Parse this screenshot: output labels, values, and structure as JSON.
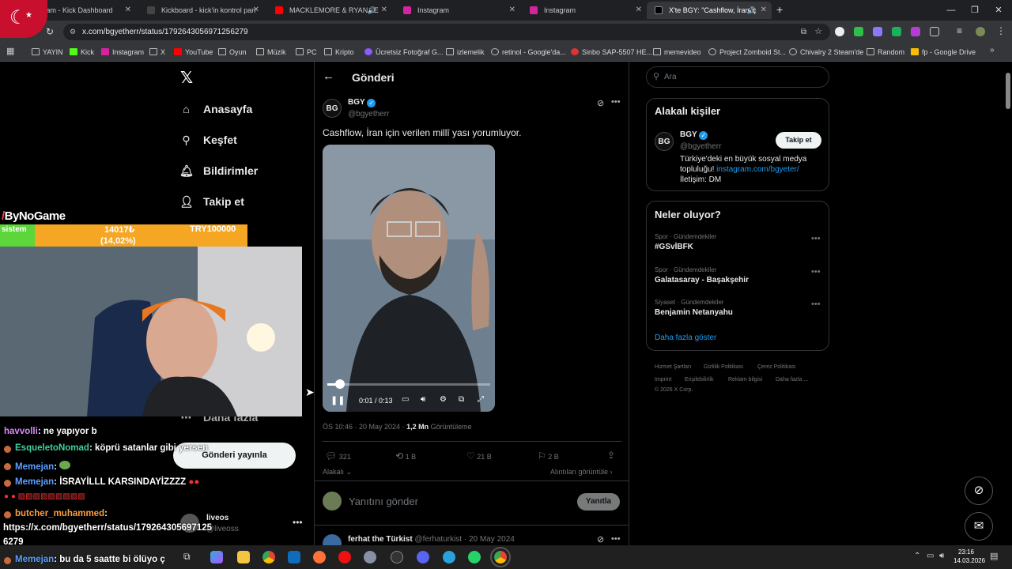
{
  "browser": {
    "tabs": [
      {
        "title": "Stream - Kick Dashboard"
      },
      {
        "title": "Kickboard - kick'in kontrol pan"
      },
      {
        "title": "MACKLEMORE & RYAN LE"
      },
      {
        "title": "Instagram"
      },
      {
        "title": "Instagram"
      },
      {
        "title": "X'te BGY: \"Cashflow, İran iç"
      }
    ],
    "url": "x.com/bgyetherr/status/1792643056971256279",
    "bookmarks": [
      "YAYIN",
      "Kick",
      "Instagram",
      "X",
      "YouTube",
      "Oyun",
      "Müzik",
      "PC",
      "Kripto",
      "Ücretsiz Fotoğraf G...",
      "izlemelik",
      "retinol - Google'da...",
      "Sinbo SAP-5507 HE...",
      "memevideo",
      "Project Zomboid St...",
      "Chivalry 2 Steam'de",
      "Random",
      "fp - Google Drive"
    ],
    "colors": {
      "tab_bar": "#1f2023",
      "toolbar": "#35363a"
    }
  },
  "nav": {
    "items": [
      {
        "label": "Anasayfa",
        "icon": "home-icon"
      },
      {
        "label": "Keşfet",
        "icon": "search-icon"
      },
      {
        "label": "Bildirimler",
        "icon": "bell-icon"
      },
      {
        "label": "Takip et",
        "icon": "add-user-icon"
      },
      {
        "label": "Daha fazla",
        "icon": "more-circle-icon"
      }
    ],
    "post_button": "Gönderi yayınla",
    "account": {
      "name": "liveos",
      "handle": "@liveoss"
    }
  },
  "post": {
    "header": "Gönderi",
    "author": "BGY",
    "handle": "@bgyetherr",
    "text": "Cashflow, İran için verilen millî yası yorumluyor.",
    "video": {
      "time": "0:01 / 0:13",
      "progress": 0.08
    },
    "date": "ÖS 10:46 · 20 May 2024",
    "views_count": "1,2 Mn",
    "views_label": "Görüntüleme",
    "stats": {
      "replies": "321",
      "reposts": "1 B",
      "likes": "21 B",
      "bookmarks": "2 B"
    },
    "relevance": "Alakalı",
    "quotes_link": "Alıntıları görüntüle",
    "reply_placeholder": "Yanıtını gönder",
    "reply_button": "Yanıtla"
  },
  "reply": {
    "name": "ferhat the Türkist",
    "handle": "@ferhaturkist",
    "date": "20 May 2024"
  },
  "search_placeholder": "Ara",
  "relevant": {
    "title": "Alakalı kişiler",
    "name": "BGY",
    "handle": "@bgyetherr",
    "follow": "Takip et",
    "bio": "Türkiye'deki en büyük sosyal medya topluluğu!",
    "bio_link": "instagram.com/bgyeter/",
    "contact": "İletişim: DM"
  },
  "trends": {
    "title": "Neler oluyor?",
    "items": [
      {
        "category": "Spor · Gündemdekiler",
        "name": "#GSvİBFK"
      },
      {
        "category": "Spor · Gündemdekiler",
        "name": "Galatasaray - Başakşehir"
      },
      {
        "category": "Siyaset · Gündemdekiler",
        "name": "Benjamin Netanyahu"
      }
    ],
    "more": "Daha fazla göster"
  },
  "footer": {
    "links": [
      "Hizmet Şartları",
      "Gizlilik Politikası",
      "Çerez Politikası",
      "Imprint",
      "Erişilebilirlik",
      "Reklam bilgisi",
      "Daha fazla ..."
    ],
    "copyright": "© 2026 X Corp."
  },
  "stream": {
    "logo": "ByNoGame",
    "goal_left": "sistem",
    "goal_value": "14017₺",
    "goal_pct": "(14,02%)",
    "goal_progress": 0.1402,
    "goal_target": "TRY100000"
  },
  "chat": [
    {
      "user": "havvolli",
      "color": "#d58cff",
      "msg": ": ne yapıyor b"
    },
    {
      "user": "EsqueletoNomad",
      "color": "#3fd1a0",
      "msg": ": köprü satanlar gibi yersen"
    },
    {
      "user": "Memejan",
      "color": "#5aa0ff",
      "msg": ": "
    },
    {
      "user": "Memejan",
      "color": "#5aa0ff",
      "msg": ": İSRAYİLLL KARSINDAYİZZZZ"
    },
    {
      "user": "butcher_muhammed",
      "color": "#ff9e3d",
      "msg": ":"
    },
    {
      "user": "",
      "color": "#ffffff",
      "msg": "https://x.com/bgyetherr/status/179264305697125"
    },
    {
      "user": "",
      "color": "#ffffff",
      "msg": "6279"
    },
    {
      "user": "Memejan",
      "color": "#5aa0ff",
      "msg": ": bu da 5 saatte bi ölüyo ç"
    }
  ],
  "taskbar": {
    "time": "23:16",
    "date": "14.03.2026"
  }
}
